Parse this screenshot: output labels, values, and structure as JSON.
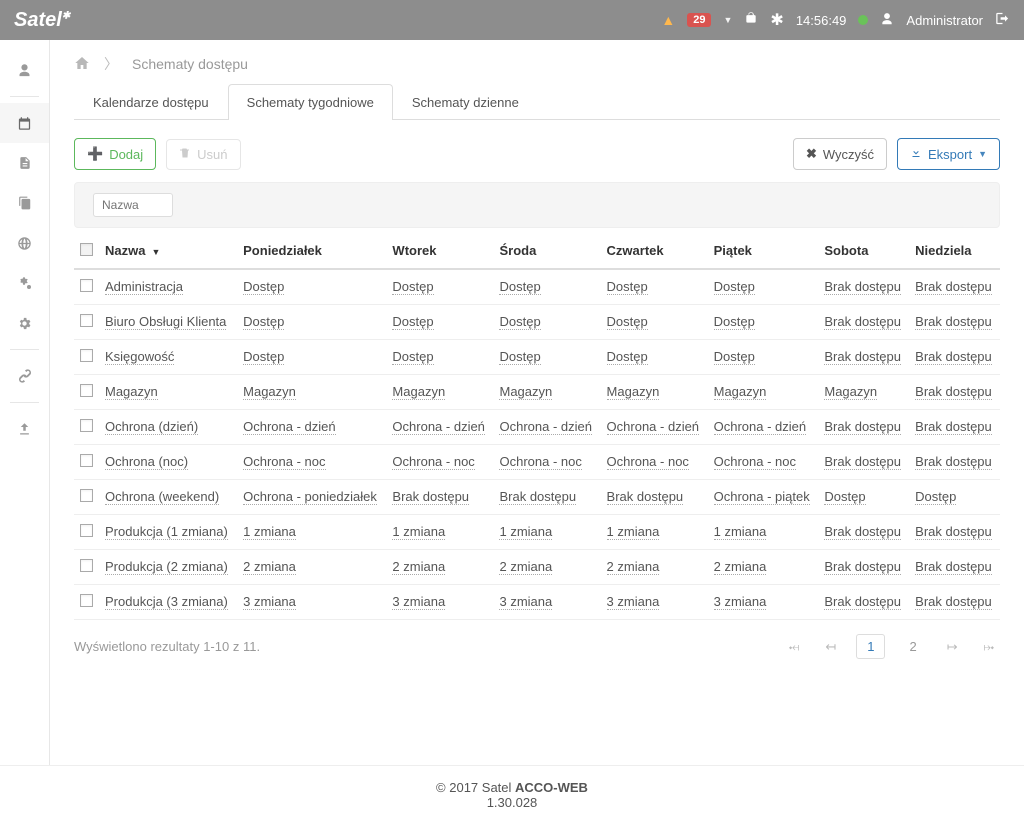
{
  "topbar": {
    "logo": "Satel",
    "badge": "29",
    "time": "14:56:49",
    "user": "Administrator"
  },
  "breadcrumb": {
    "title": "Schematy dostępu"
  },
  "tabs": [
    {
      "label": "Kalendarze dostępu",
      "active": false
    },
    {
      "label": "Schematy tygodniowe",
      "active": true
    },
    {
      "label": "Schematy dzienne",
      "active": false
    }
  ],
  "buttons": {
    "add": "Dodaj",
    "delete": "Usuń",
    "clear": "Wyczyść",
    "export": "Eksport"
  },
  "filter": {
    "name_placeholder": "Nazwa"
  },
  "headers": {
    "name": "Nazwa",
    "mon": "Poniedziałek",
    "tue": "Wtorek",
    "wed": "Środa",
    "thu": "Czwartek",
    "fri": "Piątek",
    "sat": "Sobota",
    "sun": "Niedziela"
  },
  "rows": [
    {
      "name": "Administracja",
      "mon": "Dostęp",
      "tue": "Dostęp",
      "wed": "Dostęp",
      "thu": "Dostęp",
      "fri": "Dostęp",
      "sat": "Brak dostępu",
      "sun": "Brak dostępu"
    },
    {
      "name": "Biuro Obsługi Klienta",
      "mon": "Dostęp",
      "tue": "Dostęp",
      "wed": "Dostęp",
      "thu": "Dostęp",
      "fri": "Dostęp",
      "sat": "Brak dostępu",
      "sun": "Brak dostępu"
    },
    {
      "name": "Księgowość",
      "mon": "Dostęp",
      "tue": "Dostęp",
      "wed": "Dostęp",
      "thu": "Dostęp",
      "fri": "Dostęp",
      "sat": "Brak dostępu",
      "sun": "Brak dostępu"
    },
    {
      "name": "Magazyn",
      "mon": "Magazyn",
      "tue": "Magazyn",
      "wed": "Magazyn",
      "thu": "Magazyn",
      "fri": "Magazyn",
      "sat": "Magazyn",
      "sun": "Brak dostępu"
    },
    {
      "name": "Ochrona (dzień)",
      "mon": "Ochrona - dzień",
      "tue": "Ochrona - dzień",
      "wed": "Ochrona - dzień",
      "thu": "Ochrona - dzień",
      "fri": "Ochrona - dzień",
      "sat": "Brak dostępu",
      "sun": "Brak dostępu"
    },
    {
      "name": "Ochrona (noc)",
      "mon": "Ochrona - noc",
      "tue": "Ochrona - noc",
      "wed": "Ochrona - noc",
      "thu": "Ochrona - noc",
      "fri": "Ochrona - noc",
      "sat": "Brak dostępu",
      "sun": "Brak dostępu"
    },
    {
      "name": "Ochrona (weekend)",
      "mon": "Ochrona - poniedziałek",
      "tue": "Brak dostępu",
      "wed": "Brak dostępu",
      "thu": "Brak dostępu",
      "fri": "Ochrona - piątek",
      "sat": "Dostęp",
      "sun": "Dostęp"
    },
    {
      "name": "Produkcja (1 zmiana)",
      "mon": "1 zmiana",
      "tue": "1 zmiana",
      "wed": "1 zmiana",
      "thu": "1 zmiana",
      "fri": "1 zmiana",
      "sat": "Brak dostępu",
      "sun": "Brak dostępu"
    },
    {
      "name": "Produkcja (2 zmiana)",
      "mon": "2 zmiana",
      "tue": "2 zmiana",
      "wed": "2 zmiana",
      "thu": "2 zmiana",
      "fri": "2 zmiana",
      "sat": "Brak dostępu",
      "sun": "Brak dostępu"
    },
    {
      "name": "Produkcja (3 zmiana)",
      "mon": "3 zmiana",
      "tue": "3 zmiana",
      "wed": "3 zmiana",
      "thu": "3 zmiana",
      "fri": "3 zmiana",
      "sat": "Brak dostępu",
      "sun": "Brak dostępu"
    }
  ],
  "results_text": "Wyświetlono rezultaty 1-10 z 11.",
  "pager": {
    "current": "1",
    "next": "2"
  },
  "footer": {
    "copyright": "© 2017 Satel ",
    "app": "ACCO-WEB",
    "version": "1.30.028"
  }
}
